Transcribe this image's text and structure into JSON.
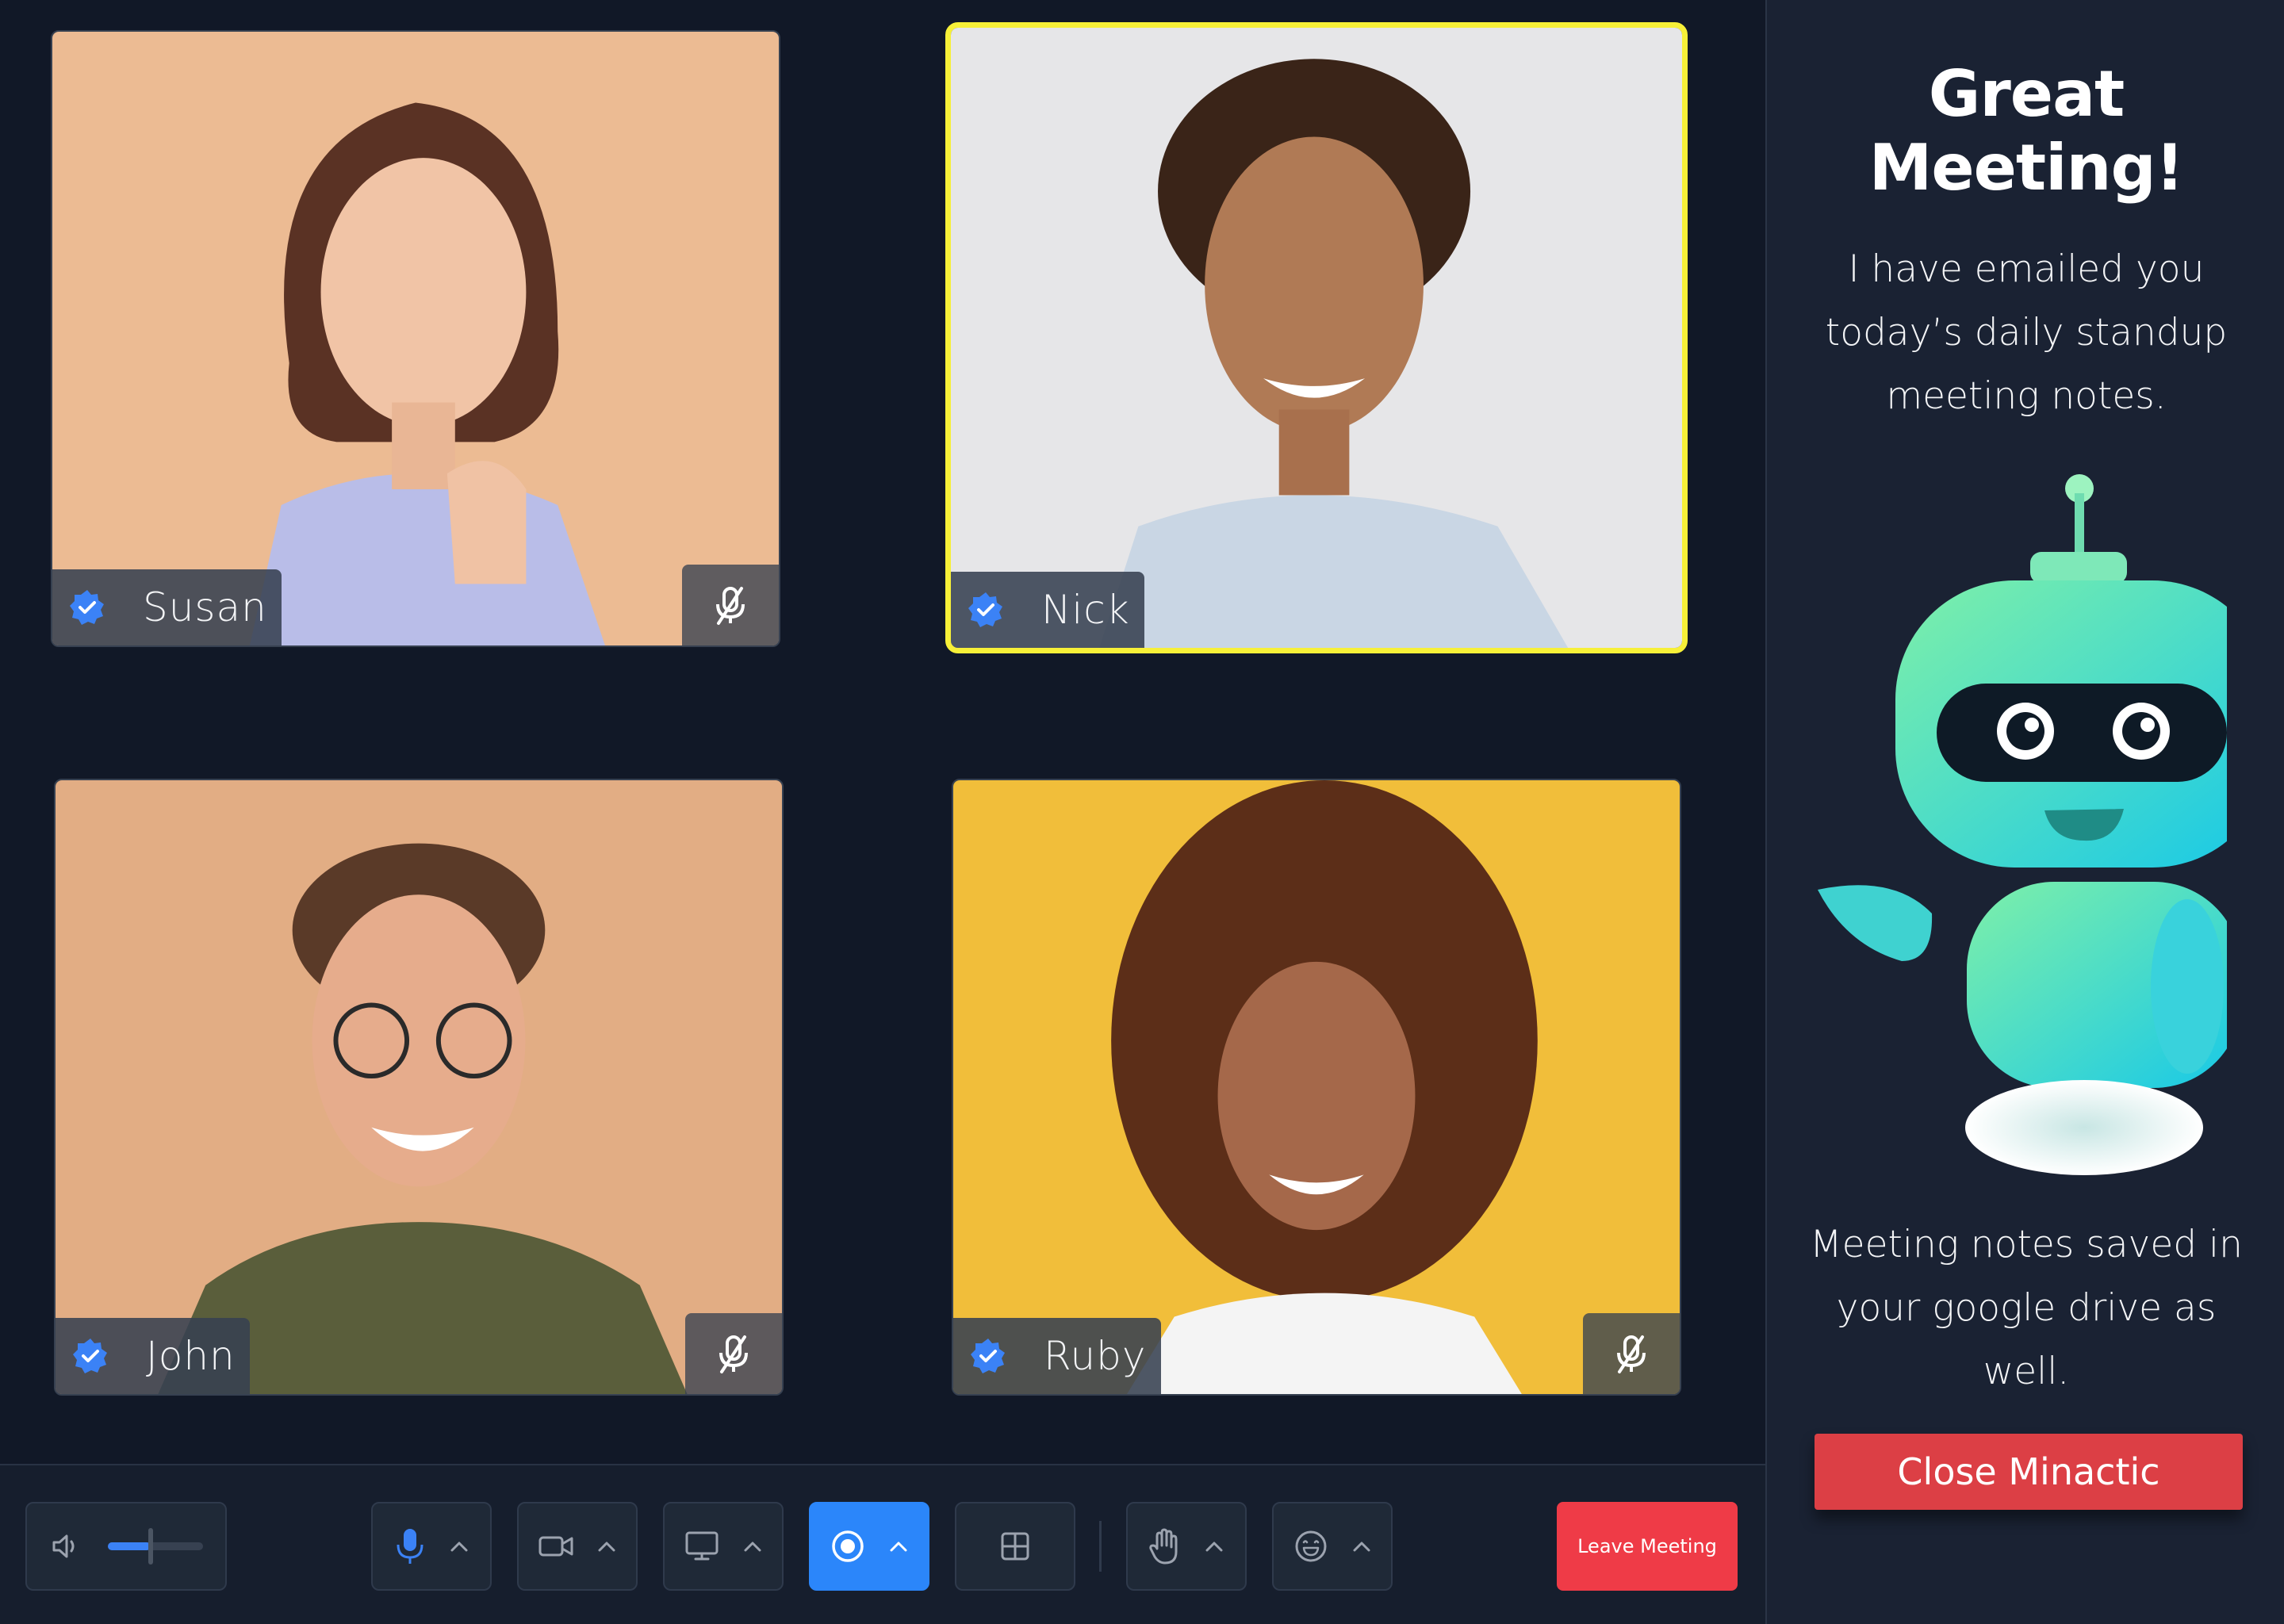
{
  "participants": [
    {
      "name": "Susan",
      "muted": true,
      "active": false,
      "background": "#ecbb93"
    },
    {
      "name": "Nick",
      "muted": false,
      "active": true,
      "background": "#e6e6e8"
    },
    {
      "name": "John",
      "muted": true,
      "active": false,
      "background": "#e2ad84"
    },
    {
      "name": "Ruby",
      "muted": true,
      "active": false,
      "background": "#f1be3a"
    }
  ],
  "panel": {
    "title": "Great Meeting!",
    "message": "I have emailed you today’s daily standup meeting notes.",
    "saved_note": "Meeting notes saved in your google drive as well.",
    "close_label": "Close Minactic"
  },
  "controls": {
    "volume_level": 0.45,
    "leave_label": "Leave Meeting",
    "items": [
      "speaker-icon",
      "microphone-icon",
      "camera-icon",
      "screen-share-icon",
      "record-icon",
      "layout-grid-icon",
      "raise-hand-icon",
      "emoji-icon"
    ]
  },
  "colors": {
    "background": "#111827",
    "active_speaker_border": "#f7f038",
    "record_accent": "#2b86fa",
    "leave_button": "#ef3b47",
    "close_button": "#dc3f45",
    "verified": "#3b82f6"
  }
}
